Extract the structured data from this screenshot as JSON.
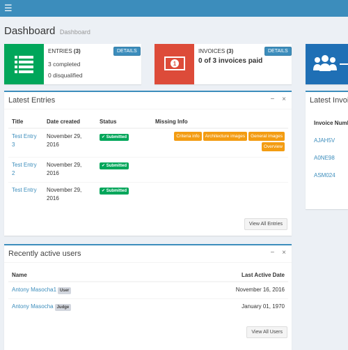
{
  "header": {
    "menu_icon": "hamburger-icon"
  },
  "page": {
    "title": "Dashboard",
    "subtitle": "Dashboard"
  },
  "infoboxes": {
    "entries": {
      "label": "ENTRIES",
      "count": "(3)",
      "line1": "3 completed",
      "line2": "0 disqualified",
      "details": "DETAILS",
      "color": "#00a65a",
      "icon": "list-icon"
    },
    "invoices": {
      "label": "INVOICES",
      "count": "(3)",
      "summary": "0 of 3 invoices paid",
      "details": "DETAILS",
      "color": "#dd4b39",
      "icon": "money-icon"
    },
    "users": {
      "color": "#1f6fb5",
      "icon": "users-icon"
    }
  },
  "latest_entries": {
    "title": "Latest Entries",
    "columns": [
      "Title",
      "Date created",
      "Status",
      "Missing Info"
    ],
    "rows": [
      {
        "title": [
          "Test Entry",
          "3"
        ],
        "date": [
          "November 29,",
          "2016"
        ],
        "status": "Submitted",
        "missing": [
          "Criteria info",
          "Architecture images",
          "General images",
          "Overview"
        ]
      },
      {
        "title": [
          "Test Entry",
          "2"
        ],
        "date": [
          "November 29,",
          "2016"
        ],
        "status": "Submitted",
        "missing": []
      },
      {
        "title": [
          "Test Entry",
          ""
        ],
        "date": [
          "November 29,",
          "2016"
        ],
        "status": "Submitted",
        "missing": []
      }
    ],
    "footer_button": "View All Entries"
  },
  "latest_invoices": {
    "title": "Latest Invoi",
    "column": "Invoice Numb",
    "rows": [
      "AJAH5V",
      "A0NE98",
      "ASM024"
    ]
  },
  "recent_users": {
    "title": "Recently active users",
    "columns": [
      "Name",
      "Last Active Date"
    ],
    "rows": [
      {
        "name": "Antony Masocha1",
        "role": "User",
        "date": "November 16, 2016"
      },
      {
        "name": "Antony Masocha",
        "role": "Judge",
        "date": "January 01, 1970"
      }
    ],
    "footer_button": "View All Users"
  },
  "box_tools": {
    "minimize": "−",
    "close": "×"
  }
}
